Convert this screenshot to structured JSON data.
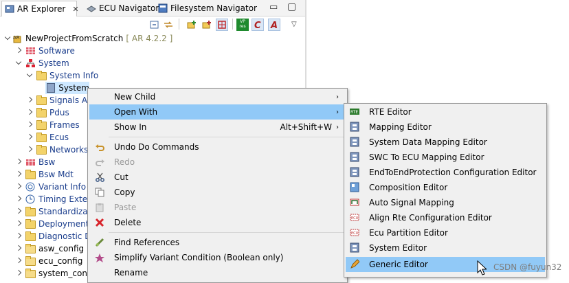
{
  "tabs": [
    {
      "label": "AR Explorer",
      "icon": "ar-explorer-icon",
      "active": true,
      "close": "✕"
    },
    {
      "label": "ECU Navigator",
      "icon": "ecu-navigator-icon"
    },
    {
      "label": "Filesystem Navigator",
      "icon": "filesystem-navigator-icon"
    }
  ],
  "window_controls": {
    "minimize": "▭",
    "maximize": "▢"
  },
  "toolbar": {
    "icons": [
      "collapse-all-icon",
      "link-with-editor-icon",
      "new-element-icon",
      "new-package-icon",
      "grid-icon",
      "vp-res-icon",
      "variant-icon",
      "filter-icon"
    ],
    "vp_text": "VP res",
    "view_menu": "▽"
  },
  "tree": {
    "project": {
      "label": "NewProjectFromScratch",
      "version": "[ AR 4.2.2 ]"
    },
    "items": [
      {
        "label": "Software",
        "icon": "software-icon"
      },
      {
        "label": "System",
        "icon": "system-icon"
      },
      {
        "label": "System Info",
        "icon": "folder-icon"
      },
      {
        "label": "System",
        "icon": "system-doc-icon"
      },
      {
        "label": "Signals Ar",
        "icon": "folder-icon"
      },
      {
        "label": "Pdus",
        "icon": "folder-icon"
      },
      {
        "label": "Frames",
        "icon": "folder-icon"
      },
      {
        "label": "Ecus",
        "icon": "folder-icon"
      },
      {
        "label": "Networks",
        "icon": "folder-icon"
      },
      {
        "label": "Bsw",
        "icon": "bsw-icon"
      },
      {
        "label": "Bsw Mdt",
        "icon": "folder-icon"
      },
      {
        "label": "Variant Info",
        "icon": "variant-info-icon"
      },
      {
        "label": "Timing Exten",
        "icon": "timing-icon"
      },
      {
        "label": "Standardizati",
        "icon": "folder-icon"
      },
      {
        "label": "Deployment",
        "icon": "folder-icon"
      },
      {
        "label": "Diagnostic De",
        "icon": "folder-icon"
      },
      {
        "label": "asw_config",
        "icon": "folder-icon"
      },
      {
        "label": "ecu_config",
        "icon": "folder-icon"
      },
      {
        "label": "system_confi",
        "icon": "folder-icon"
      }
    ]
  },
  "context_menu": {
    "items": [
      {
        "label": "New Child",
        "submenu": "›"
      },
      {
        "label": "Open With",
        "submenu": "›",
        "highlighted": true
      },
      {
        "label": "Show In",
        "accel": "Alt+Shift+W",
        "submenu": "›"
      },
      {
        "label": "Undo Do Commands",
        "icon": "undo-icon"
      },
      {
        "label": "Redo",
        "icon": "redo-icon",
        "disabled": true
      },
      {
        "label": "Cut",
        "icon": "cut-icon"
      },
      {
        "label": "Copy",
        "icon": "copy-icon"
      },
      {
        "label": "Paste",
        "icon": "paste-icon",
        "disabled": true
      },
      {
        "label": "Delete",
        "icon": "delete-icon"
      },
      {
        "label": "Find References",
        "icon": "find-references-icon"
      },
      {
        "label": "Simplify Variant Condition (Boolean only)",
        "icon": "simplify-icon"
      },
      {
        "label": "Rename"
      }
    ]
  },
  "open_with_menu": {
    "items": [
      {
        "label": "RTE Editor",
        "icon": "rte-editor-icon"
      },
      {
        "label": "Mapping Editor",
        "icon": "mapping-editor-icon"
      },
      {
        "label": "System Data Mapping Editor",
        "icon": "mapping-editor-icon"
      },
      {
        "label": "SWC To ECU Mapping Editor",
        "icon": "mapping-editor-icon"
      },
      {
        "label": "EndToEndProtection Configuration Editor",
        "icon": "mapping-editor-icon"
      },
      {
        "label": "Composition Editor",
        "icon": "composition-editor-icon"
      },
      {
        "label": "Auto Signal Mapping",
        "icon": "auto-signal-mapping-icon"
      },
      {
        "label": "Align Rte Configuration Editor",
        "icon": "ecu-editor-icon"
      },
      {
        "label": "Ecu Partition Editor",
        "icon": "ecu-editor-icon"
      },
      {
        "label": "System Editor",
        "icon": "mapping-editor-icon"
      },
      {
        "label": "Generic Editor",
        "icon": "pencil-icon",
        "highlighted": true
      }
    ]
  },
  "watermark": "CSDN @fuyun32",
  "colors": {
    "menu_highlight": "#91c9f7",
    "tree_link": "#1a3d8c",
    "selection": "#cde8ff"
  }
}
